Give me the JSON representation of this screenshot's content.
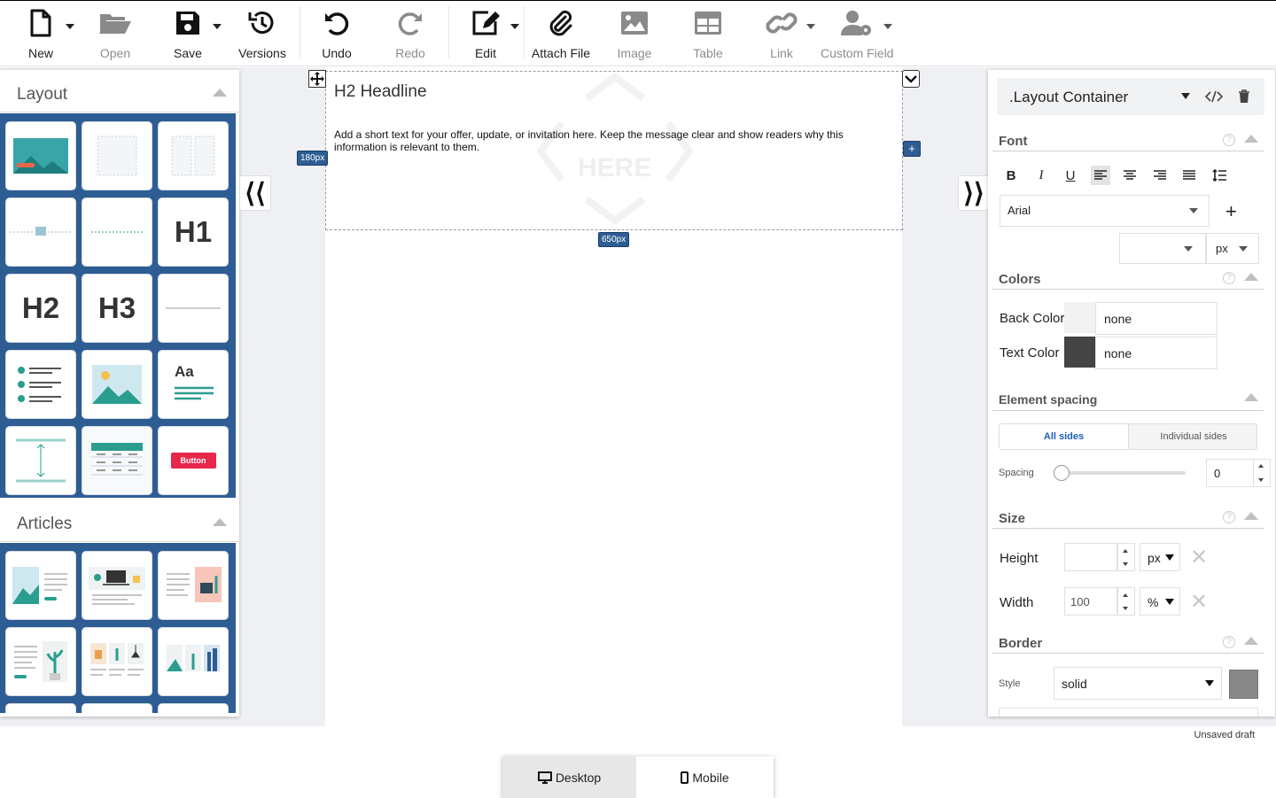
{
  "toolbar": {
    "new": "New",
    "open": "Open",
    "save": "Save",
    "versions": "Versions",
    "undo": "Undo",
    "redo": "Redo",
    "edit": "Edit",
    "attach": "Attach File",
    "image": "Image",
    "table": "Table",
    "link": "Link",
    "custom_field": "Custom Field"
  },
  "left_panel": {
    "layout_title": "Layout",
    "articles_title": "Articles",
    "tiles": {
      "h1": "H1",
      "h2": "H2",
      "h3": "H3",
      "aa": "Aa",
      "button": "Button"
    }
  },
  "canvas": {
    "headline": "H2 Headline",
    "body": "Add a short text for your offer, update, or invitation here. Keep the message clear and show readers why this information is relevant to them.",
    "height_badge": "180px",
    "width_badge": "650px",
    "placeholder": "HERE"
  },
  "right_panel": {
    "selected": ".Layout Container",
    "font_title": "Font",
    "font_family": "Arial",
    "font_unit": "px",
    "colors_title": "Colors",
    "back_color_label": "Back Color",
    "back_color_value": "none",
    "text_color_label": "Text Color",
    "text_color_value": "none",
    "spacing_title": "Element spacing",
    "all_sides": "All sides",
    "individual_sides": "Individual sides",
    "spacing_label": "Spacing",
    "spacing_value": "0",
    "size_title": "Size",
    "height_label": "Height",
    "height_unit": "px",
    "width_label": "Width",
    "width_value": "100",
    "width_unit": "%",
    "border_title": "Border",
    "style_label": "Style",
    "style_value": "solid"
  },
  "footer": {
    "status": "Unsaved draft",
    "desktop": "Desktop",
    "mobile": "Mobile"
  },
  "colors": {
    "accent": "#2e5d94",
    "teal": "#2a9d8f",
    "tile_red": "#e8274b"
  }
}
